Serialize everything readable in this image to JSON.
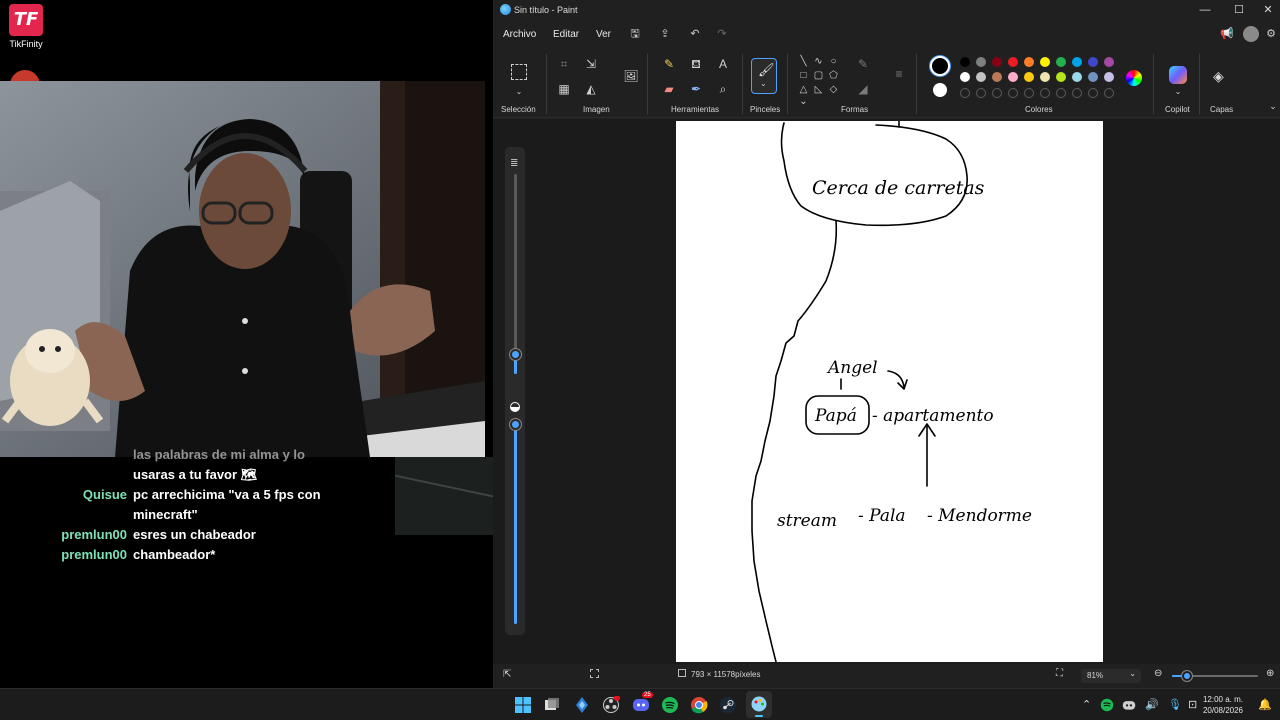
{
  "desktop": {
    "app_shortcut": {
      "label": "TikFinity",
      "logo_letters": "TF"
    }
  },
  "chat": {
    "messages": [
      {
        "user": "",
        "text": "las palabras de mi alma y lo"
      },
      {
        "user": "",
        "text": "usaras a tu favor 🗺"
      },
      {
        "user": "Quisue",
        "text": "pc arrechicima \"va a 5 fps con"
      },
      {
        "user": "",
        "text": "minecraft\""
      },
      {
        "user": "premlun00",
        "text": "esres un chabeador"
      },
      {
        "user": "premlun00",
        "text": "chambeador*"
      }
    ],
    "user_color": "#7fe0b8"
  },
  "paint": {
    "title": "Sin título - Paint",
    "window_controls": {
      "minimize": "—",
      "maximize": "☐",
      "close": "✕"
    },
    "menu": [
      "Archivo",
      "Editar",
      "Ver"
    ],
    "ribbon_groups": {
      "selection": "Selección",
      "image": "Imagen",
      "tools": "Herramientas",
      "brushes": "Pinceles",
      "shapes": "Formas",
      "colors": "Colores",
      "copilot": "Copilot",
      "layers": "Capas"
    },
    "palette_row1": [
      "#000000",
      "#7f7f7f",
      "#880015",
      "#ed1c24",
      "#ff7f27",
      "#fff200",
      "#22b14c",
      "#00a2e8",
      "#3f48cc",
      "#a349a4"
    ],
    "palette_row2": [
      "#ffffff",
      "#c3c3c3",
      "#b97a57",
      "#ffaec9",
      "#ffc90e",
      "#efe4b0",
      "#b5e61d",
      "#99d9ea",
      "#7092be",
      "#c8bfe7"
    ],
    "primary_color": "#000000",
    "secondary_color": "#ffffff",
    "accent": "#4da3ff",
    "canvas_text": {
      "bubble": "Cerca de carretas",
      "person": "Angel",
      "boxed": "Papá",
      "right_of_box": "- apartamento",
      "bottom_left": "stream",
      "bottom_mid": "- Pala",
      "bottom_right": "- Mendorme"
    },
    "status": {
      "canvas_size": "793 × 11578píxeles",
      "zoom": "81%",
      "zoom_level": 0.18
    },
    "brush_size_level": 0.1,
    "opacity_level": 1.0
  },
  "taskbar": {
    "clock_time": "12:00 a. m.",
    "clock_date": "20/08/2026",
    "discord_badge": "25"
  }
}
